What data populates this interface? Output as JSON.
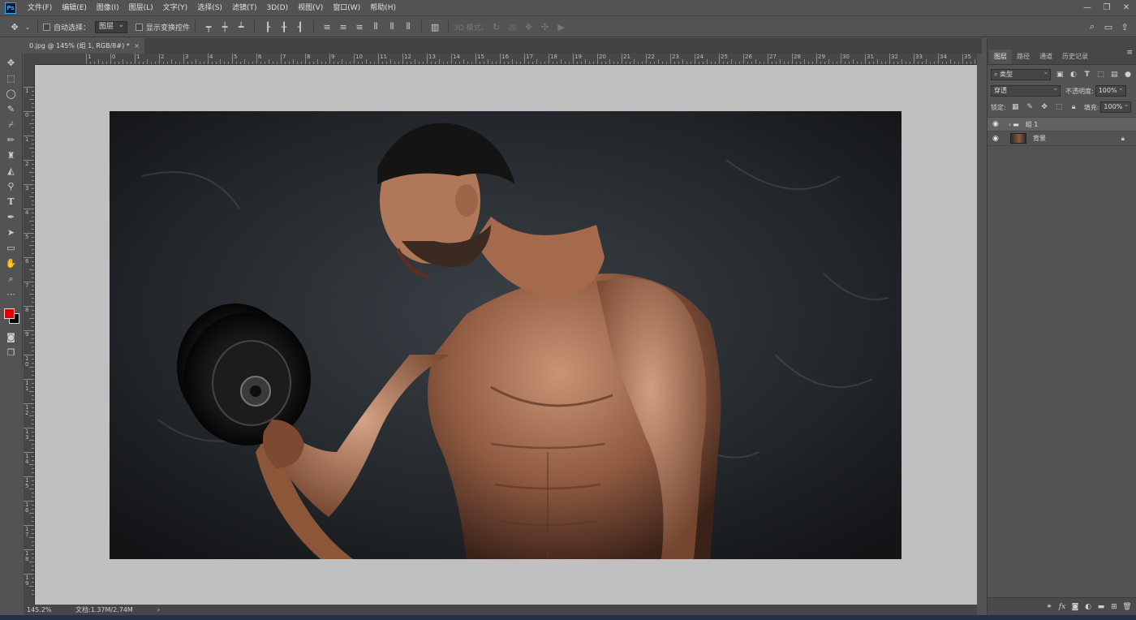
{
  "app": {
    "logo": "Ps"
  },
  "menu": [
    "文件(F)",
    "编辑(E)",
    "图像(I)",
    "图层(L)",
    "文字(Y)",
    "选择(S)",
    "滤镜(T)",
    "3D(D)",
    "视图(V)",
    "窗口(W)",
    "帮助(H)"
  ],
  "window_controls": {
    "minimize": "—",
    "restore": "❐",
    "close": "✕"
  },
  "options": {
    "move_icon": "move-icon",
    "auto_select_label": "自动选择：",
    "auto_select_value": "图层",
    "show_transform_label": "显示变换控件",
    "mode_3d_label": "3D 模式："
  },
  "document": {
    "tab_title": "0.jpg @ 145% (组 1, RGB/8#) *",
    "tab_close": "×"
  },
  "ruler_top": [
    "1",
    "0",
    "1",
    "2",
    "3",
    "4",
    "5",
    "6",
    "7",
    "8",
    "9",
    "10",
    "11",
    "12",
    "13",
    "14",
    "15",
    "16",
    "17",
    "18",
    "19",
    "20",
    "21",
    "22",
    "23",
    "24",
    "25",
    "26",
    "27",
    "28",
    "29",
    "30",
    "31",
    "32",
    "33",
    "34",
    "35"
  ],
  "ruler_left": [
    "1",
    "0",
    "1",
    "2",
    "3",
    "4",
    "5",
    "6",
    "7",
    "8",
    "9",
    "1\n0",
    "1\n1",
    "1\n2",
    "1\n3",
    "1\n4",
    "1\n5",
    "1\n6",
    "1\n7",
    "1\n8",
    "1\n9"
  ],
  "status": {
    "zoom": "145.2%",
    "doc_info": "文档:1.37M/2.74M",
    "arrow": "›"
  },
  "panel": {
    "tabs": [
      "图层",
      "路径",
      "通道",
      "历史记录"
    ],
    "filter_label": "类型",
    "blend_mode": "穿透",
    "opacity_label": "不透明度:",
    "opacity_value": "100%",
    "lock_label": "锁定:",
    "fill_label": "填充:",
    "fill_value": "100%",
    "layers": [
      {
        "name": "组 1",
        "type": "group"
      },
      {
        "name": "背景",
        "type": "background"
      }
    ]
  },
  "colors": {
    "foreground": "#e40000",
    "background": "#000000",
    "accent": "#31a8ff"
  }
}
